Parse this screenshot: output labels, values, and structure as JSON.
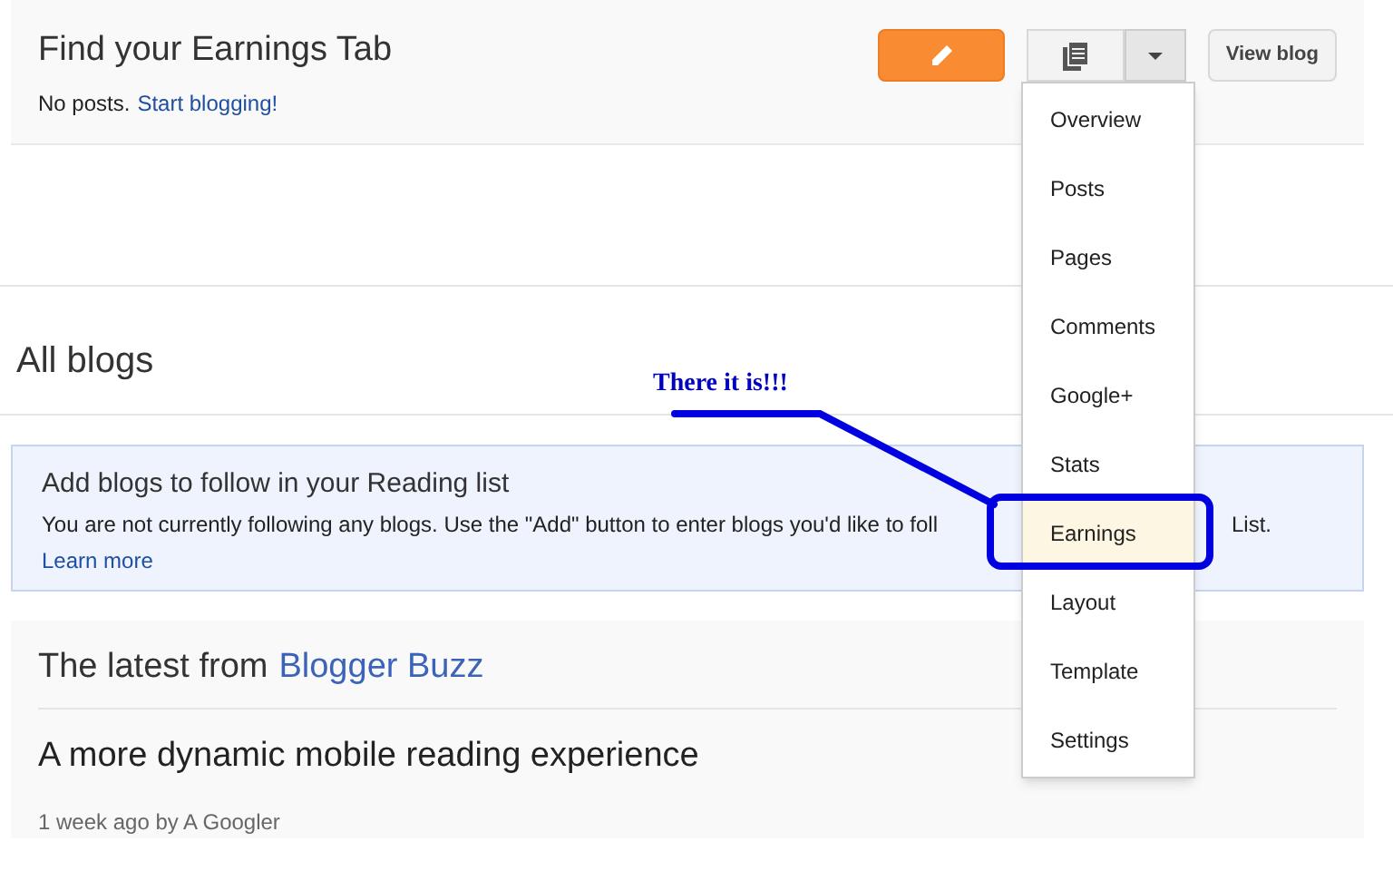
{
  "blog_card": {
    "title": "Find your Earnings Tab",
    "status": "No posts.",
    "status_link": "Start blogging!",
    "view_button": "View blog"
  },
  "menu": {
    "items": [
      {
        "label": "Overview",
        "selected": false
      },
      {
        "label": "Posts",
        "selected": false
      },
      {
        "label": "Pages",
        "selected": false
      },
      {
        "label": "Comments",
        "selected": false
      },
      {
        "label": "Google+",
        "selected": false
      },
      {
        "label": "Stats",
        "selected": false
      },
      {
        "label": "Earnings",
        "selected": true
      },
      {
        "label": "Layout",
        "selected": false
      },
      {
        "label": "Template",
        "selected": false
      },
      {
        "label": "Settings",
        "selected": false
      }
    ]
  },
  "all_blogs": {
    "heading": "All blogs"
  },
  "notice": {
    "title": "Add blogs to follow in your Reading list",
    "text_visible_start": "You are not currently following any blogs. Use the \"Add\" button to enter blogs you'd like to foll",
    "text_visible_end": "List.",
    "link": "Learn more"
  },
  "buzz": {
    "heading_prefix": "The latest from",
    "heading_link": "Blogger Buzz",
    "post_title": "A more dynamic mobile reading experience",
    "post_meta": "1 week ago by A Googler"
  },
  "annotation": {
    "text": "There it is!!!"
  }
}
